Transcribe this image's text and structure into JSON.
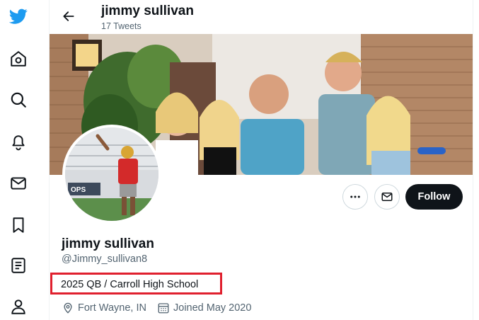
{
  "nav": {
    "items": [
      {
        "icon": "twitter-logo-icon"
      },
      {
        "icon": "home-icon"
      },
      {
        "icon": "explore-search-icon"
      },
      {
        "icon": "notifications-bell-icon"
      },
      {
        "icon": "messages-envelope-icon"
      },
      {
        "icon": "bookmarks-icon"
      },
      {
        "icon": "lists-icon"
      },
      {
        "icon": "profile-person-icon"
      }
    ],
    "brand_color": "#1d9bf0"
  },
  "header": {
    "title": "jimmy sullivan",
    "subtitle": "17 Tweets"
  },
  "profile": {
    "name": "jimmy sullivan",
    "handle": "@Jimmy_sullivan8",
    "bio": "2025 QB / Carroll High School",
    "location": "Fort Wayne, IN",
    "joined": "Joined May 2020",
    "follow_label": "Follow",
    "avatar_banner_text": "OPS"
  },
  "colors": {
    "text_primary": "#0f1419",
    "text_secondary": "#536471",
    "follow_bg": "#0f1419",
    "highlight_border": "#e0202e"
  }
}
